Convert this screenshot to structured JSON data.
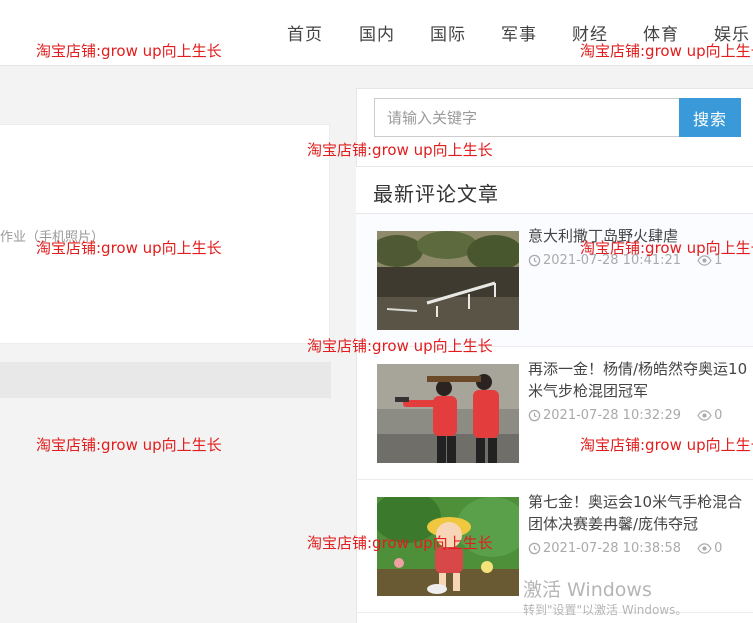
{
  "nav": {
    "items": [
      "首页",
      "国内",
      "国际",
      "军事",
      "财经",
      "体育",
      "娱乐"
    ]
  },
  "main": {
    "card_text": "作业（手机照片）"
  },
  "search": {
    "placeholder": "请输入关键字",
    "button_label": "搜索"
  },
  "sidebar": {
    "section_title": "最新评论文章",
    "articles": [
      {
        "title": "意大利撒丁岛野火肆虐",
        "date": "2021-07-28 10:41:21",
        "views": "1"
      },
      {
        "title": "再添一金！杨倩/杨皓然夺奥运10米气步枪混团冠军",
        "date": "2021-07-28 10:32:29",
        "views": "0"
      },
      {
        "title": "第七金！奥运会10米气手枪混合团体决赛姜冉馨/庞伟夺冠",
        "date": "2021-07-28 10:38:58",
        "views": "0"
      }
    ]
  },
  "watermark": {
    "text": "淘宝店铺:grow up向上生长"
  },
  "windows": {
    "activate_title": "激活 Windows",
    "activate_sub": "转到\"设置\"以激活 Windows。"
  },
  "colors": {
    "accent": "#3a9ad9",
    "watermark": "#e11d1d"
  }
}
